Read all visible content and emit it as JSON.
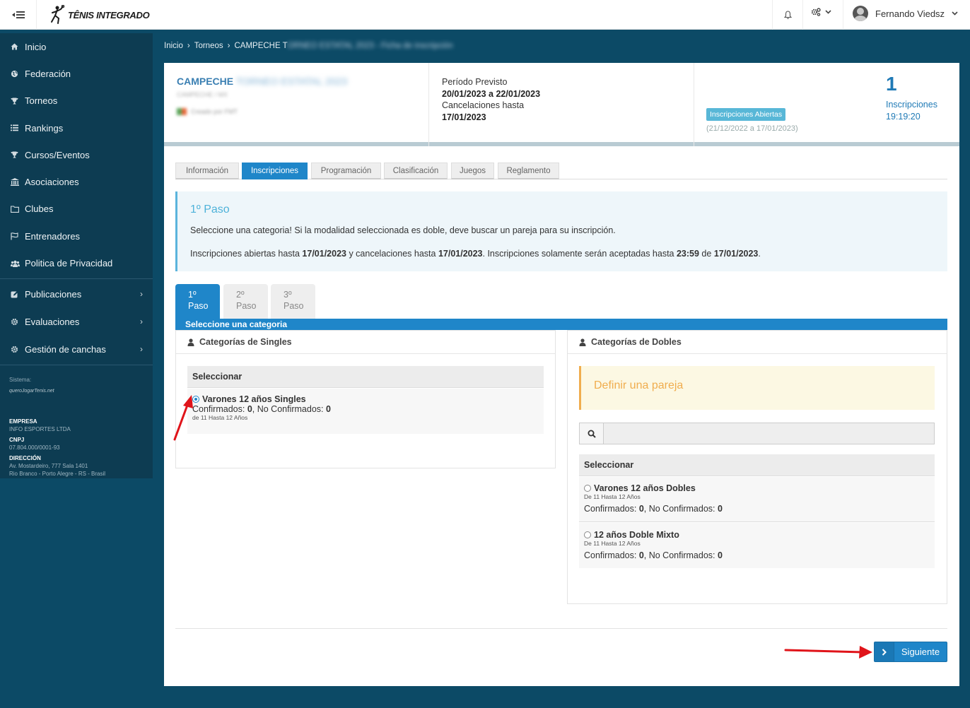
{
  "topbar": {
    "brand": "TÊNIS INTEGRADO",
    "user_name": "Fernando Viedsz"
  },
  "sidebar": {
    "items": [
      {
        "label": "Inicio",
        "icon": "home-icon"
      },
      {
        "label": "Federación",
        "icon": "globe-icon"
      },
      {
        "label": "Torneos",
        "icon": "trophy-icon"
      },
      {
        "label": "Rankings",
        "icon": "list-icon"
      },
      {
        "label": "Cursos/Eventos",
        "icon": "trophy-icon"
      },
      {
        "label": "Asociaciones",
        "icon": "institution-icon"
      },
      {
        "label": "Clubes",
        "icon": "folder-icon"
      },
      {
        "label": "Entrenadores",
        "icon": "flag-icon"
      },
      {
        "label": "Politica de Privacidad",
        "icon": "users-icon"
      }
    ],
    "expandable": [
      {
        "label": "Publicaciones",
        "icon": "edit-icon"
      },
      {
        "label": "Evaluaciones",
        "icon": "gear-icon"
      },
      {
        "label": "Gestión de canchas",
        "icon": "gear-icon"
      }
    ],
    "sistema_label": "Sistema:",
    "sistema_logo": "queroJogarTenis.net",
    "empresa_label": "EMPRESA",
    "empresa_value": "INFO ESPORTES LTDA",
    "cnpj_label": "CNPJ",
    "cnpj_value": "07.804.000/0001-93",
    "direccion_label": "DIRECCIÓN",
    "direccion_line1": "Av. Mostardeiro, 777 Sala 1401",
    "direccion_line2": "Rio Branco - Porto Alegre - RS - Brasil"
  },
  "breadcrumb": {
    "items": [
      "Inicio",
      "Torneos",
      "CAMPECHE T"
    ],
    "blurred": "ORNEO ESTATAL 2023 - Ficha de inscripción"
  },
  "tournament": {
    "title": "CAMPECHE",
    "title_blurred": "TORNEO ESTATAL 2023",
    "subtitle_blurred": "CAMPECHE / MX",
    "org_blurred": "Creado por FMT",
    "periodo_label": "Período Previsto",
    "periodo_value": "20/01/2023 a 22/01/2023",
    "cancel_label": "Cancelaciones hasta",
    "cancel_value": "17/01/2023",
    "status_badge": "Inscripciones Abiertas",
    "status_dates": "(21/12/2022 a 17/01/2023)",
    "count": "1",
    "count_label": "Inscripciones",
    "count_time": "19:19:20"
  },
  "tabs": [
    {
      "label": "Información",
      "active": false
    },
    {
      "label": "Inscripciones",
      "active": true
    },
    {
      "label": "Programación",
      "active": false
    },
    {
      "label": "Clasificación",
      "active": false
    },
    {
      "label": "Juegos",
      "active": false
    },
    {
      "label": "Reglamento",
      "active": false
    }
  ],
  "info": {
    "title": "1º Paso",
    "line1": "Seleccione una categoria! Si la modalidad seleccionada es doble, deve buscar un pareja para su inscripción.",
    "line2_a": "Inscripciones abiertas hasta ",
    "line2_b": "17/01/2023",
    "line2_c": " y cancelaciones hasta ",
    "line2_d": "17/01/2023",
    "line2_e": ". Inscripciones solamente serán aceptadas hasta ",
    "line2_f": "23:59",
    "line2_g": " de ",
    "line2_h": "17/01/2023",
    "line2_i": "."
  },
  "steps": [
    {
      "num": "1º",
      "label": "Paso",
      "active": true
    },
    {
      "num": "2º",
      "label": "Paso",
      "active": false
    },
    {
      "num": "3º",
      "label": "Paso",
      "active": false
    }
  ],
  "step_bar": "Seleccione una categoria",
  "singles": {
    "title": "Categorías de Singles",
    "select_header": "Seleccionar",
    "items": [
      {
        "name": "Varones 12 años Singles",
        "confirmed_label": "Confirmados: ",
        "confirmed": "0",
        "unconfirmed_label": ", No Confirmados: ",
        "unconfirmed": "0",
        "range": "de 11 Hasta 12 Años",
        "selected": true
      }
    ]
  },
  "doubles": {
    "title": "Categorías de Dobles",
    "warning": "Definir una pareja",
    "search_value": "",
    "select_header": "Seleccionar",
    "items": [
      {
        "name": "Varones 12 años Dobles",
        "range": "De 11 Hasta 12 Años",
        "confirmed_label": "Confirmados: ",
        "confirmed": "0",
        "unconfirmed_label": ", No Confirmados: ",
        "unconfirmed": "0",
        "selected": false
      },
      {
        "name": "12 años Doble Mixto",
        "range": "De 11 Hasta 12 Años",
        "confirmed_label": "Confirmados: ",
        "confirmed": "0",
        "unconfirmed_label": ", No Confirmados: ",
        "unconfirmed": "0",
        "selected": false
      }
    ]
  },
  "next_button": "Siguiente",
  "colors": {
    "primary": "#1f86c9",
    "sidebar": "#0d3c52",
    "background": "#0c4a66",
    "warning": "#f0ad4e",
    "annotation_arrow": "#e0141a"
  }
}
